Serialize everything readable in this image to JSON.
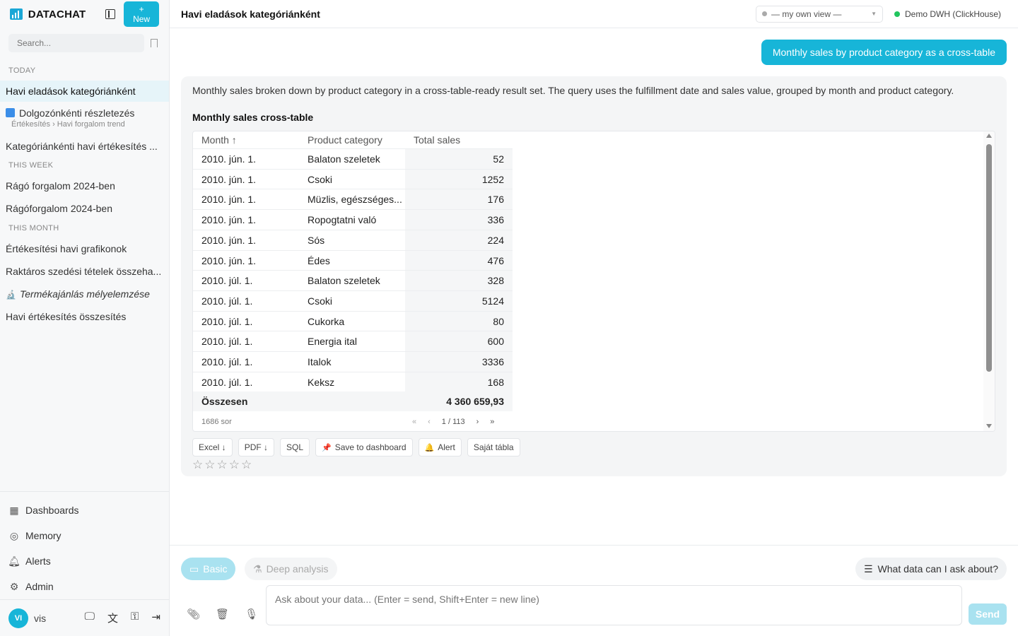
{
  "app": {
    "name": "DATACHAT",
    "new_label": "+ New"
  },
  "sidebar": {
    "search_placeholder": "Search...",
    "sections": {
      "today": "TODAY",
      "this_week": "THIS WEEK",
      "this_month": "THIS MONTH"
    },
    "today": [
      {
        "label": "Havi eladások kategóriánként",
        "active": true
      },
      {
        "label": "Dolgozónkénti részletezés",
        "sub": "Értékesítés › Havi forgalom trend",
        "icon": "drilldown-icon"
      },
      {
        "label": "Kategóriánkénti havi értékesítés ..."
      }
    ],
    "this_week": [
      {
        "label": "Rágó forgalom 2024-ben"
      },
      {
        "label": "Rágóforgalom 2024-ben"
      }
    ],
    "this_month": [
      {
        "label": "Értékesítési havi grafikonok"
      },
      {
        "label": "Raktáros szedési tételek összeha..."
      },
      {
        "label": "Termékajánlás mélyelemzése",
        "icon": "microscope-icon",
        "italic": true
      },
      {
        "label": "Havi értékesítés összesítés"
      }
    ],
    "nav": [
      {
        "label": "Dashboards",
        "icon": "dashboard-icon"
      },
      {
        "label": "Memory",
        "icon": "brain-icon"
      },
      {
        "label": "Alerts",
        "icon": "bell-icon"
      },
      {
        "label": "Admin",
        "icon": "gear-icon"
      }
    ],
    "user": {
      "initials": "VI",
      "name": "vis"
    }
  },
  "topbar": {
    "title": "Havi eladások kategóriánként",
    "view": "— my own view —",
    "db": "Demo DWH (ClickHouse)"
  },
  "chat": {
    "user_message": "Monthly sales by product category as a cross-table",
    "answer_text": "Monthly sales broken down by product category in a cross-table-ready result set. The query uses the fulfillment date and sales value, grouped by month and product category.",
    "table_title": "Monthly sales cross-table",
    "columns": [
      "Month ↑",
      "Product category",
      "Total sales"
    ],
    "rows": [
      [
        "2010. jún. 1.",
        "Balaton szeletek",
        "52"
      ],
      [
        "2010. jún. 1.",
        "Csoki",
        "1252"
      ],
      [
        "2010. jún. 1.",
        "Müzlis, egészséges...",
        "176"
      ],
      [
        "2010. jún. 1.",
        "Ropogtatni való",
        "336"
      ],
      [
        "2010. jún. 1.",
        "Sós",
        "224"
      ],
      [
        "2010. jún. 1.",
        "Édes",
        "476"
      ],
      [
        "2010. júl. 1.",
        "Balaton szeletek",
        "328"
      ],
      [
        "2010. júl. 1.",
        "Csoki",
        "5124"
      ],
      [
        "2010. júl. 1.",
        "Cukorka",
        "80"
      ],
      [
        "2010. júl. 1.",
        "Energia ital",
        "600"
      ],
      [
        "2010. júl. 1.",
        "Italok",
        "3336"
      ],
      [
        "2010. júl. 1.",
        "Keksz",
        "168"
      ]
    ],
    "total_label": "Összesen",
    "total_value": "4 360 659,93",
    "row_count": "1686 sor",
    "pager": {
      "first": "«",
      "prev": "‹",
      "page": "1 / 113",
      "next": "›",
      "last": "»"
    },
    "actions": [
      "Excel ↓",
      "PDF ↓",
      "SQL",
      "Save to dashboard",
      "Alert",
      "Saját tábla"
    ],
    "rating": {
      "max": 5,
      "value": 0
    }
  },
  "composer": {
    "mode_basic": "Basic",
    "mode_deep": "Deep analysis",
    "ask_about": "What data can I ask about?",
    "placeholder": "Ask about your data... (Enter = send, Shift+Enter = new line)",
    "send": "Send"
  },
  "colors": {
    "accent": "#17b5d8",
    "status_ok": "#22c55e"
  }
}
